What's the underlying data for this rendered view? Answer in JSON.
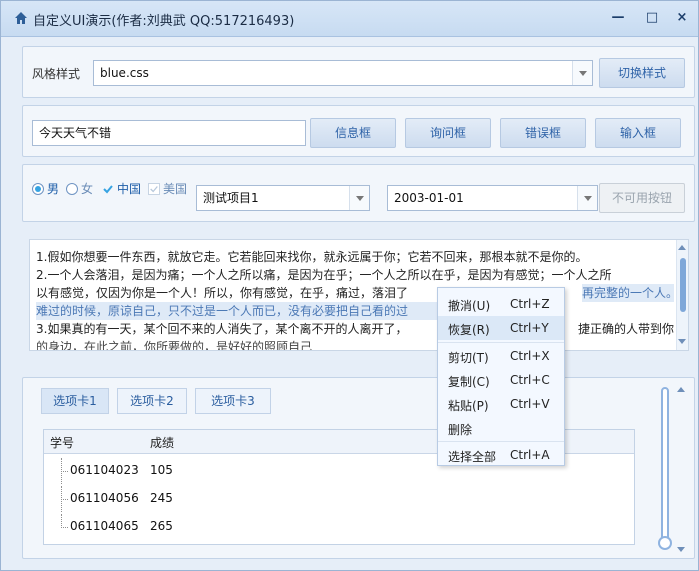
{
  "window": {
    "title": "自定义UI演示(作者:刘典武 QQ:517216493)",
    "icon": "home-icon",
    "controls": {
      "minimize": "—",
      "maximize": "□",
      "close": "×"
    }
  },
  "style_panel": {
    "label": "风格样式",
    "selected": "blue.css",
    "switch_button": "切换样式"
  },
  "message_panel": {
    "text_input": "今天天气不错",
    "buttons": [
      "信息框",
      "询问框",
      "错误框",
      "输入框"
    ]
  },
  "options_panel": {
    "radio_male": "男",
    "radio_female": "女",
    "check_china": "中国",
    "check_usa": "美国",
    "combo_project": "测试项目1",
    "combo_date": "2003-01-01",
    "disabled_button": "不可用按钮"
  },
  "text_area": {
    "lines": [
      "1.假如你想要一件东西，就放它走。它若能回来找你，就永远属于你；它若不回来，那根本就不是你的。",
      "2.一个人会落泪，是因为痛；一个人之所以痛，是因为在乎；一个人之所以在乎，是因为有感觉；一个人之所",
      "以有感觉，仅因为你是一个人！所以，你有感觉，在乎，痛过，落泪了",
      "难过的时候，原谅自己，只不过是一个人而已，没有必要把自己看的过",
      "3.如果真的有一天，某个回不来的人消失了，某个离不开的人离开了，",
      "的身边，在此之前，你所要做的，是好好的照顾自己"
    ],
    "line3_tail": "再完整的一个人。",
    "line5_tail": "捷正确的人带到你"
  },
  "tabs": [
    "选项卡1",
    "选项卡2",
    "选项卡3"
  ],
  "table": {
    "headers": [
      "学号",
      "成绩"
    ],
    "rows": [
      {
        "id": "061104023",
        "score": "105"
      },
      {
        "id": "061104056",
        "score": "245"
      },
      {
        "id": "061104065",
        "score": "265"
      }
    ]
  },
  "context_menu": [
    {
      "label": "撤消(U)",
      "shortcut": "Ctrl+Z"
    },
    {
      "label": "恢复(R)",
      "shortcut": "Ctrl+Y"
    },
    {
      "label": "剪切(T)",
      "shortcut": "Ctrl+X"
    },
    {
      "label": "复制(C)",
      "shortcut": "Ctrl+C"
    },
    {
      "label": "粘贴(P)",
      "shortcut": "Ctrl+V"
    },
    {
      "label": "删除",
      "shortcut": ""
    },
    {
      "label": "选择全部",
      "shortcut": "Ctrl+A"
    }
  ],
  "colors": {
    "accent": "#36a3e2",
    "button_text": "#2f63a8",
    "selection_text": "#4b78b5"
  }
}
